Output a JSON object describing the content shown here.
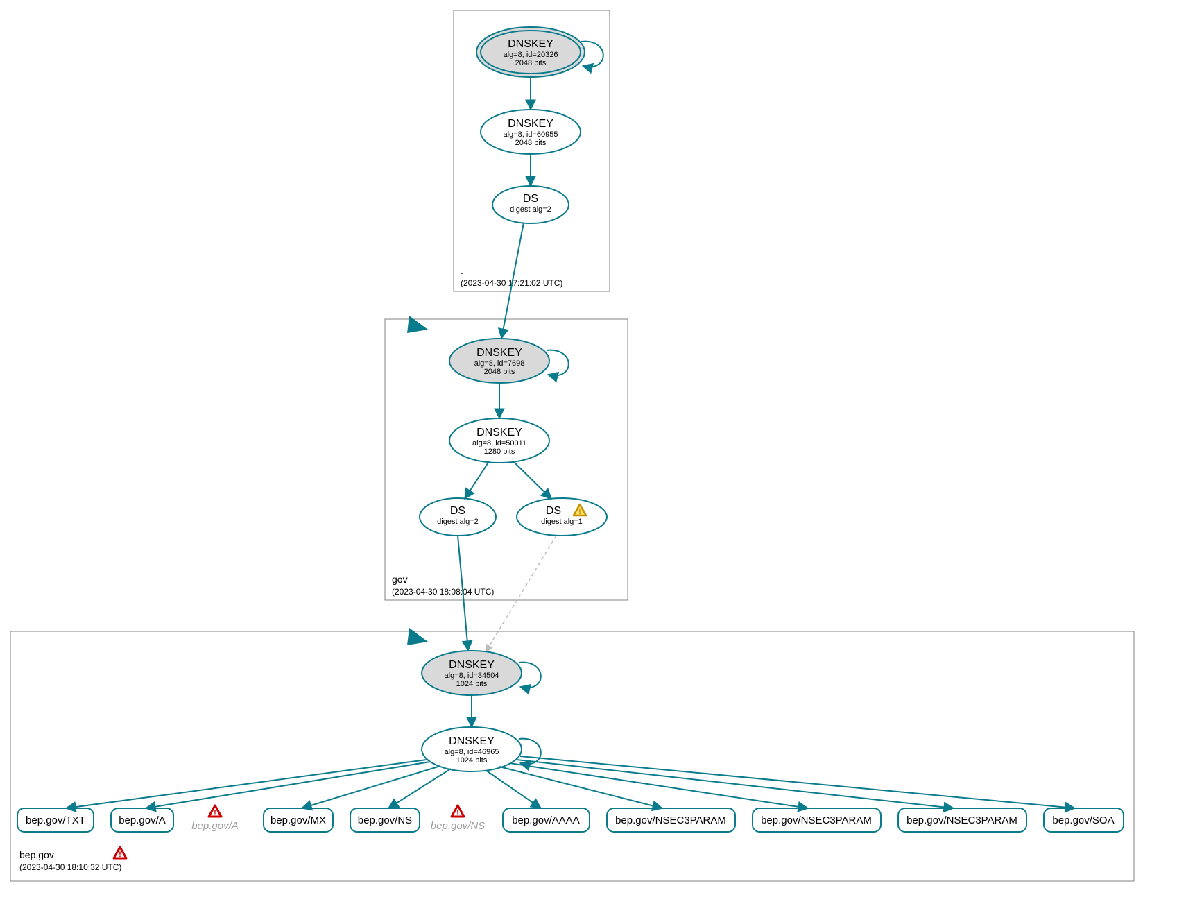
{
  "zones": {
    "root": {
      "label": ".",
      "timestamp": "(2023-04-30 17:21:02 UTC)"
    },
    "gov": {
      "label": "gov",
      "timestamp": "(2023-04-30 18:08:04 UTC)"
    },
    "bep": {
      "label": "bep.gov",
      "timestamp": "(2023-04-30 18:10:32 UTC)"
    }
  },
  "nodes": {
    "root_ksk": {
      "title": "DNSKEY",
      "sub1": "alg=8, id=20326",
      "sub2": "2048 bits"
    },
    "root_zsk": {
      "title": "DNSKEY",
      "sub1": "alg=8, id=60955",
      "sub2": "2048 bits"
    },
    "root_ds": {
      "title": "DS",
      "sub1": "digest alg=2"
    },
    "gov_ksk": {
      "title": "DNSKEY",
      "sub1": "alg=8, id=7698",
      "sub2": "2048 bits"
    },
    "gov_zsk": {
      "title": "DNSKEY",
      "sub1": "alg=8, id=50011",
      "sub2": "1280 bits"
    },
    "gov_ds1": {
      "title": "DS",
      "sub1": "digest alg=2"
    },
    "gov_ds2": {
      "title": "DS",
      "sub1": "digest alg=1"
    },
    "bep_ksk": {
      "title": "DNSKEY",
      "sub1": "alg=8, id=34504",
      "sub2": "1024 bits"
    },
    "bep_zsk": {
      "title": "DNSKEY",
      "sub1": "alg=8, id=46965",
      "sub2": "1024 bits"
    }
  },
  "rr": {
    "txt": "bep.gov/TXT",
    "a": "bep.gov/A",
    "a_err": "bep.gov/A",
    "mx": "bep.gov/MX",
    "ns": "bep.gov/NS",
    "ns_err": "bep.gov/NS",
    "aaaa": "bep.gov/AAAA",
    "nsec1": "bep.gov/NSEC3PARAM",
    "nsec2": "bep.gov/NSEC3PARAM",
    "nsec3": "bep.gov/NSEC3PARAM",
    "soa": "bep.gov/SOA"
  }
}
